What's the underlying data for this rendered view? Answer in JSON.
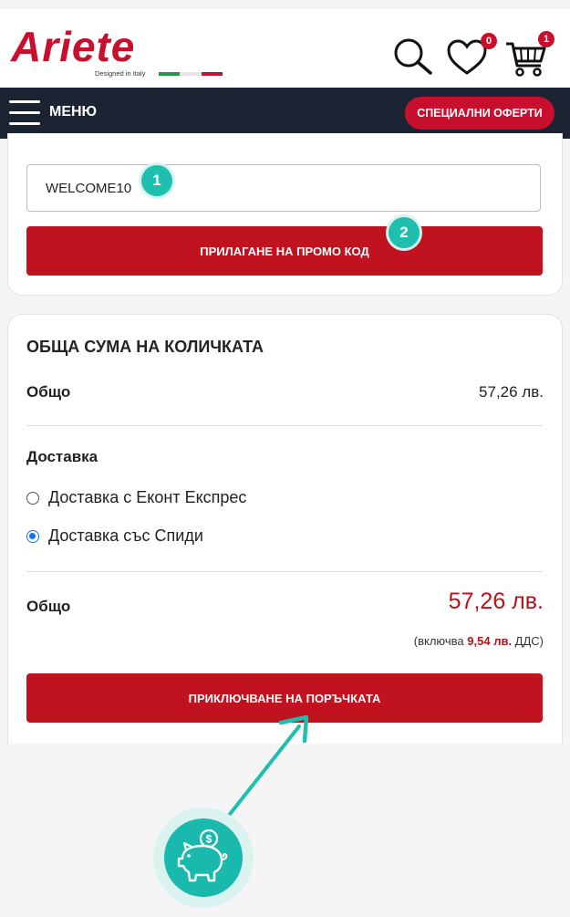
{
  "header": {
    "logo_text": "Ariete",
    "logo_tagline": "Designed in Italy",
    "wishlist_count": "0",
    "cart_count": "1"
  },
  "nav": {
    "menu_label": "МЕНЮ",
    "offers_label": "СПЕЦИАЛНИ ОФЕРТИ"
  },
  "promo": {
    "code_value": "WELCOME10",
    "apply_label": "ПРИЛАГАНЕ НА ПРОМО КОД",
    "step1": "1",
    "step2": "2"
  },
  "totals": {
    "title": "ОБЩА СУМА НА КОЛИЧКАТА",
    "subtotal_label": "Общо",
    "subtotal_value": "57,26 лв.",
    "shipping_label": "Доставка",
    "shipping_options": [
      {
        "label": "Доставка с Еконт Експрес",
        "selected": false
      },
      {
        "label": "Доставка със Спиди",
        "selected": true
      }
    ],
    "total_label": "Общо",
    "total_value": "57,26 лв.",
    "vat_prefix": "(включва ",
    "vat_amount": "9,54 лв.",
    "vat_suffix": " ДДС)",
    "checkout_label": "ПРИКЛЮЧВАНЕ НА ПОРЪЧКАТА"
  },
  "colors": {
    "brand_red": "#c8102e",
    "navbar": "#1c2333",
    "annotation_teal": "#1fbfb0"
  },
  "icons": [
    "hamburger-menu-icon",
    "search-icon",
    "heart-icon",
    "cart-icon",
    "piggy-bank-icon",
    "arrow-icon"
  ]
}
